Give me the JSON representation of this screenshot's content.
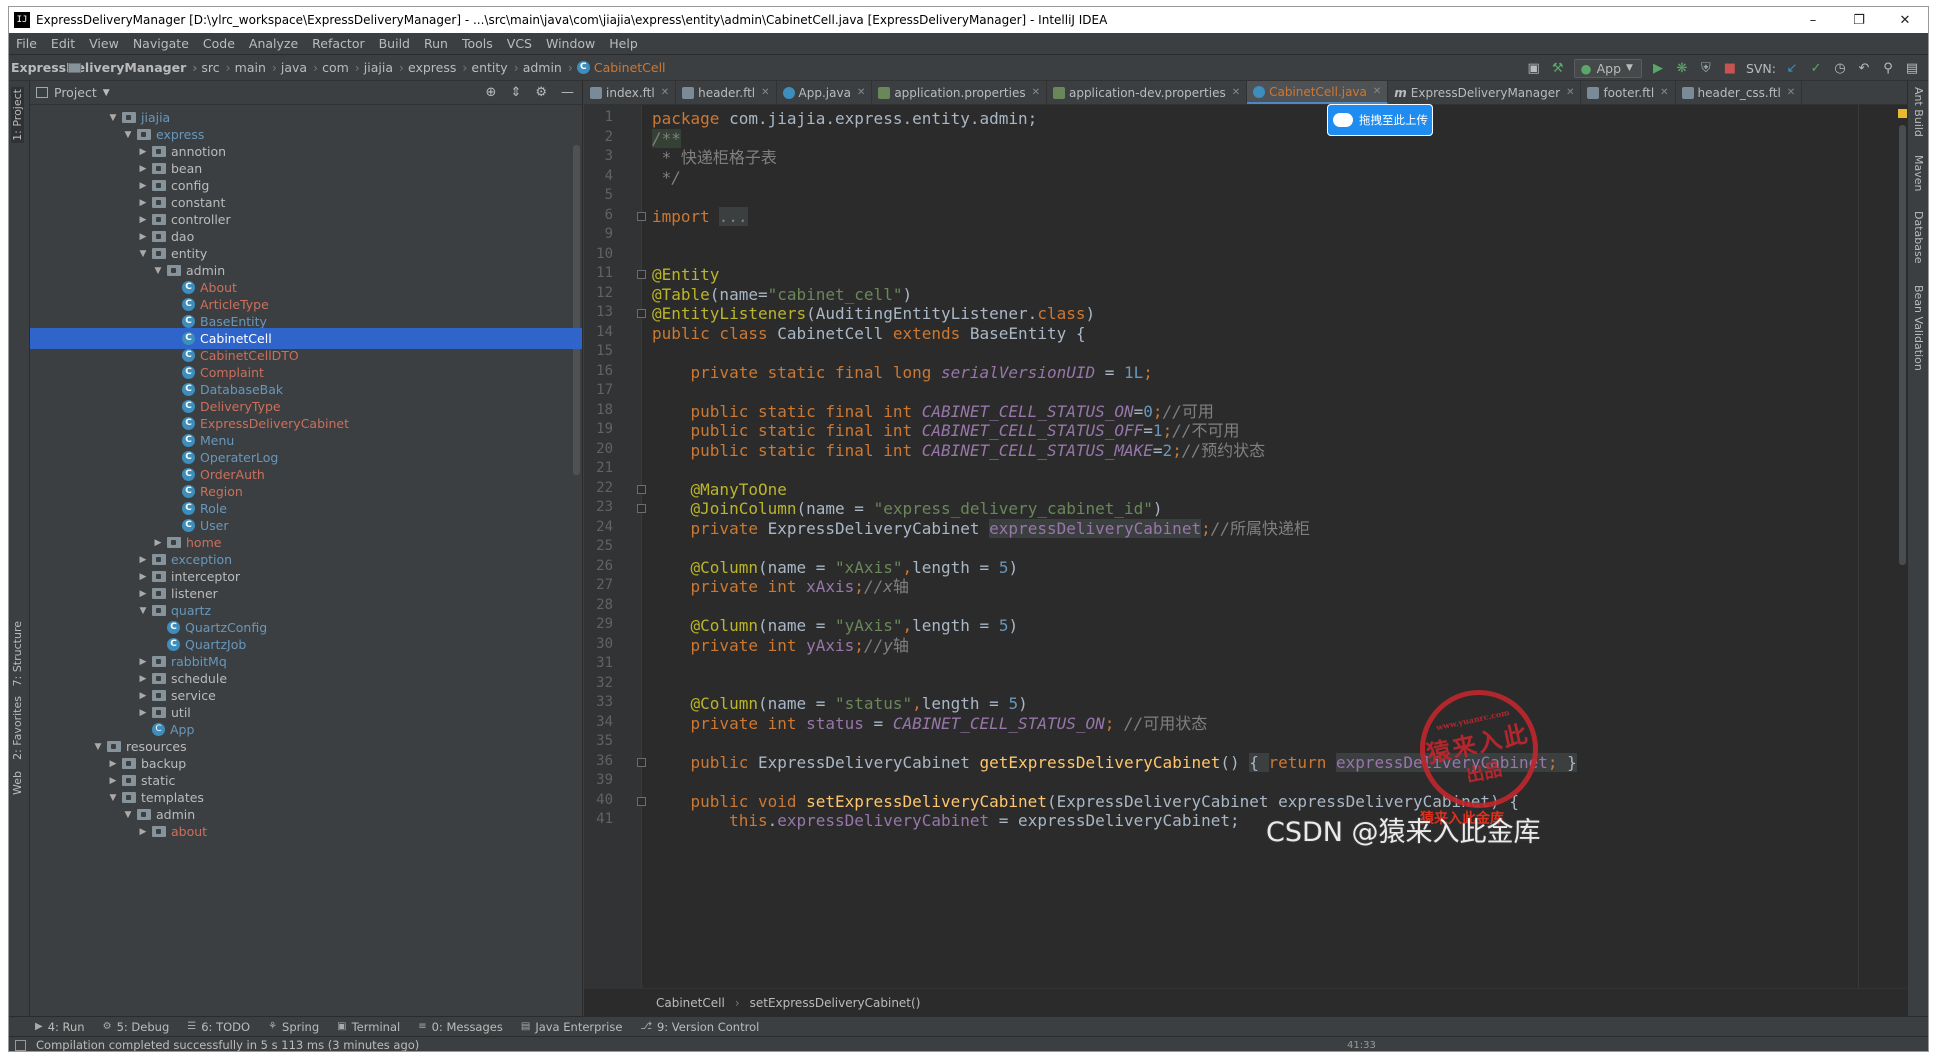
{
  "window": {
    "title": "ExpressDeliveryManager [D:\\ylrc_workspace\\ExpressDeliveryManager] - ...\\src\\main\\java\\com\\jiajia\\express\\entity\\admin\\CabinetCell.java [ExpressDeliveryManager] - IntelliJ IDEA",
    "controls": [
      "–",
      "❐",
      "✕"
    ]
  },
  "menu": [
    "File",
    "Edit",
    "View",
    "Navigate",
    "Code",
    "Analyze",
    "Refactor",
    "Build",
    "Run",
    "Tools",
    "VCS",
    "Window",
    "Help"
  ],
  "breadcrumbs": [
    "ExpressDeliveryManager",
    "src",
    "main",
    "java",
    "com",
    "jiajia",
    "express",
    "entity",
    "admin",
    "CabinetCell"
  ],
  "toolbar": {
    "run_config": "App",
    "svn_label": "SVN:"
  },
  "left_strip": {
    "project": "1: Project",
    "structure": "7: Structure",
    "favorites": "2: Favorites",
    "web": "Web"
  },
  "right_strip": {
    "ant": "Ant Build",
    "maven": "Maven",
    "database": "Database",
    "bean": "Bean Validation"
  },
  "project_panel": {
    "title": "Project",
    "tree": [
      {
        "label": "jiajia",
        "depth": 0,
        "kind": "pkg",
        "open": true,
        "style": "mod"
      },
      {
        "label": "express",
        "depth": 1,
        "kind": "pkg",
        "open": true,
        "style": "mod"
      },
      {
        "label": "annotion",
        "depth": 2,
        "kind": "pkg",
        "open": false,
        "style": ""
      },
      {
        "label": "bean",
        "depth": 2,
        "kind": "pkg",
        "open": false,
        "style": ""
      },
      {
        "label": "config",
        "depth": 2,
        "kind": "pkg",
        "open": false,
        "style": ""
      },
      {
        "label": "constant",
        "depth": 2,
        "kind": "pkg",
        "open": false,
        "style": ""
      },
      {
        "label": "controller",
        "depth": 2,
        "kind": "pkg",
        "open": false,
        "style": ""
      },
      {
        "label": "dao",
        "depth": 2,
        "kind": "pkg",
        "open": false,
        "style": ""
      },
      {
        "label": "entity",
        "depth": 2,
        "kind": "pkg",
        "open": true,
        "style": ""
      },
      {
        "label": "admin",
        "depth": 3,
        "kind": "pkg",
        "open": true,
        "style": ""
      },
      {
        "label": "About",
        "depth": 4,
        "kind": "class",
        "style": "err"
      },
      {
        "label": "ArticleType",
        "depth": 4,
        "kind": "class",
        "style": "err"
      },
      {
        "label": "BaseEntity",
        "depth": 4,
        "kind": "class",
        "style": "chg"
      },
      {
        "label": "CabinetCell",
        "depth": 4,
        "kind": "class",
        "style": "sel"
      },
      {
        "label": "CabinetCellDTO",
        "depth": 4,
        "kind": "class",
        "style": "err"
      },
      {
        "label": "Complaint",
        "depth": 4,
        "kind": "class",
        "style": "err"
      },
      {
        "label": "DatabaseBak",
        "depth": 4,
        "kind": "class",
        "style": "chg"
      },
      {
        "label": "DeliveryType",
        "depth": 4,
        "kind": "class",
        "style": "err"
      },
      {
        "label": "ExpressDeliveryCabinet",
        "depth": 4,
        "kind": "class",
        "style": "err"
      },
      {
        "label": "Menu",
        "depth": 4,
        "kind": "class",
        "style": "chg"
      },
      {
        "label": "OperaterLog",
        "depth": 4,
        "kind": "class",
        "style": "chg"
      },
      {
        "label": "OrderAuth",
        "depth": 4,
        "kind": "class",
        "style": "err"
      },
      {
        "label": "Region",
        "depth": 4,
        "kind": "class",
        "style": "err"
      },
      {
        "label": "Role",
        "depth": 4,
        "kind": "class",
        "style": "chg"
      },
      {
        "label": "User",
        "depth": 4,
        "kind": "class",
        "style": "chg"
      },
      {
        "label": "home",
        "depth": 3,
        "kind": "pkg",
        "open": false,
        "style": "err"
      },
      {
        "label": "exception",
        "depth": 2,
        "kind": "pkg",
        "open": false,
        "style": "mod"
      },
      {
        "label": "interceptor",
        "depth": 2,
        "kind": "pkg",
        "open": false,
        "style": ""
      },
      {
        "label": "listener",
        "depth": 2,
        "kind": "pkg",
        "open": false,
        "style": ""
      },
      {
        "label": "quartz",
        "depth": 2,
        "kind": "pkg",
        "open": true,
        "style": "mod"
      },
      {
        "label": "QuartzConfig",
        "depth": 3,
        "kind": "class",
        "style": "mod"
      },
      {
        "label": "QuartzJob",
        "depth": 3,
        "kind": "class",
        "style": "mod"
      },
      {
        "label": "rabbitMq",
        "depth": 2,
        "kind": "pkg",
        "open": false,
        "style": "mod"
      },
      {
        "label": "schedule",
        "depth": 2,
        "kind": "pkg",
        "open": false,
        "style": ""
      },
      {
        "label": "service",
        "depth": 2,
        "kind": "pkg",
        "open": false,
        "style": ""
      },
      {
        "label": "util",
        "depth": 2,
        "kind": "pkg",
        "open": false,
        "style": ""
      },
      {
        "label": "App",
        "depth": 2,
        "kind": "app",
        "style": "chg"
      },
      {
        "label": "resources",
        "depth": -1,
        "kind": "pkg",
        "open": true,
        "style": ""
      },
      {
        "label": "backup",
        "depth": 0,
        "kind": "pkg",
        "open": false,
        "style": ""
      },
      {
        "label": "static",
        "depth": 0,
        "kind": "pkg",
        "open": false,
        "style": ""
      },
      {
        "label": "templates",
        "depth": 0,
        "kind": "pkg",
        "open": true,
        "style": ""
      },
      {
        "label": "admin",
        "depth": 1,
        "kind": "pkg",
        "open": true,
        "style": ""
      },
      {
        "label": "about",
        "depth": 2,
        "kind": "pkg",
        "open": false,
        "style": "err"
      }
    ]
  },
  "tabs": [
    {
      "label": "index.ftl",
      "active": false,
      "icon": "ftl"
    },
    {
      "label": "header.ftl",
      "active": false,
      "icon": "ftl"
    },
    {
      "label": "App.java",
      "active": false,
      "icon": "class"
    },
    {
      "label": "application.properties",
      "active": false,
      "icon": "props"
    },
    {
      "label": "application-dev.properties",
      "active": false,
      "icon": "props"
    },
    {
      "label": "CabinetCell.java",
      "active": true,
      "icon": "class"
    },
    {
      "label": "ExpressDeliveryManager",
      "active": false,
      "icon": "maven"
    },
    {
      "label": "footer.ftl",
      "active": false,
      "icon": "ftl"
    },
    {
      "label": "header_css.ftl",
      "active": false,
      "icon": "ftl"
    }
  ],
  "upload_button": "拖拽至此上传",
  "code": {
    "line_numbers": [
      "1",
      "2",
      "3",
      "4",
      "5",
      "6",
      "9",
      "10",
      "11",
      "12",
      "13",
      "14",
      "15",
      "16",
      "17",
      "18",
      "19",
      "20",
      "21",
      "22",
      "23",
      "24",
      "25",
      "26",
      "27",
      "28",
      "29",
      "30",
      "31",
      "32",
      "33",
      "34",
      "35",
      "36",
      "39",
      "40",
      "41"
    ],
    "lines": [
      [
        [
          "kw",
          "package "
        ],
        [
          "",
          "com.jiajia.express.entity.admin;"
        ]
      ],
      [
        [
          "cm hl",
          "/**"
        ]
      ],
      [
        [
          "cm",
          " * "
        ],
        [
          "cmz",
          "快递柜格子表"
        ]
      ],
      [
        [
          "cm",
          " */"
        ]
      ],
      [
        [
          "",
          ""
        ]
      ],
      [
        [
          "kw",
          "import "
        ],
        [
          "hlg cm",
          "..."
        ]
      ],
      [
        [
          "",
          ""
        ]
      ],
      [
        [
          "",
          ""
        ]
      ],
      [
        [
          "an",
          "@Entity"
        ]
      ],
      [
        [
          "an",
          "@Table"
        ],
        [
          "",
          "(name="
        ],
        [
          "st",
          "\"cabinet_cell\""
        ],
        [
          "",
          ")"
        ]
      ],
      [
        [
          "an",
          "@EntityListeners"
        ],
        [
          "",
          "(AuditingEntityListener."
        ],
        [
          "kw",
          "class"
        ],
        [
          "",
          ")"
        ]
      ],
      [
        [
          "kw",
          "public class "
        ],
        [
          "",
          "CabinetCell "
        ],
        [
          "kw",
          "extends "
        ],
        [
          "",
          "BaseEntity {"
        ]
      ],
      [
        [
          "",
          ""
        ]
      ],
      [
        [
          "",
          "    "
        ],
        [
          "kw",
          "private static final long "
        ],
        [
          "ic",
          "serialVersionUID"
        ],
        [
          "",
          " = "
        ],
        [
          "nm",
          "1L"
        ],
        [
          "kw",
          ";"
        ]
      ],
      [
        [
          "",
          ""
        ]
      ],
      [
        [
          "",
          "    "
        ],
        [
          "kw",
          "public static final int "
        ],
        [
          "ic",
          "CABINET_CELL_STATUS_ON"
        ],
        [
          "",
          "="
        ],
        [
          "nm",
          "0"
        ],
        [
          "kw",
          ";"
        ],
        [
          "cm",
          "//"
        ],
        [
          "cmz",
          "可用"
        ]
      ],
      [
        [
          "",
          "    "
        ],
        [
          "kw",
          "public static final int "
        ],
        [
          "ic",
          "CABINET_CELL_STATUS_OFF"
        ],
        [
          "",
          "="
        ],
        [
          "nm",
          "1"
        ],
        [
          "kw",
          ";"
        ],
        [
          "cm",
          "//"
        ],
        [
          "cmz",
          "不可用"
        ]
      ],
      [
        [
          "",
          "    "
        ],
        [
          "kw",
          "public static final int "
        ],
        [
          "ic",
          "CABINET_CELL_STATUS_MAKE"
        ],
        [
          "",
          "="
        ],
        [
          "nm",
          "2"
        ],
        [
          "kw",
          ";"
        ],
        [
          "cm",
          "//"
        ],
        [
          "cmz",
          "预约状态"
        ]
      ],
      [
        [
          "",
          ""
        ]
      ],
      [
        [
          "",
          "    "
        ],
        [
          "an",
          "@ManyToOne"
        ]
      ],
      [
        [
          "",
          "    "
        ],
        [
          "an",
          "@JoinColumn"
        ],
        [
          "",
          "(name = "
        ],
        [
          "st",
          "\"express_delivery_cabinet_id\""
        ],
        [
          "",
          ")"
        ]
      ],
      [
        [
          "",
          "    "
        ],
        [
          "kw",
          "private "
        ],
        [
          "",
          "ExpressDeliveryCabinet "
        ],
        [
          "fieldref hlg",
          "expressDeliveryCabinet"
        ],
        [
          "kw",
          ";"
        ],
        [
          "cm",
          "//"
        ],
        [
          "cmz",
          "所属快递柜"
        ]
      ],
      [
        [
          "",
          ""
        ]
      ],
      [
        [
          "",
          "    "
        ],
        [
          "an",
          "@Column"
        ],
        [
          "",
          "(name = "
        ],
        [
          "st",
          "\"xAxis\""
        ],
        [
          "kw",
          ","
        ],
        [
          "",
          "length = "
        ],
        [
          "nm",
          "5"
        ],
        [
          "",
          ")"
        ]
      ],
      [
        [
          "",
          "    "
        ],
        [
          "kw",
          "private int "
        ],
        [
          "fieldref",
          "xAxis"
        ],
        [
          "kw",
          ";"
        ],
        [
          "cm",
          "//x"
        ],
        [
          "cmz",
          "轴"
        ]
      ],
      [
        [
          "",
          ""
        ]
      ],
      [
        [
          "",
          "    "
        ],
        [
          "an",
          "@Column"
        ],
        [
          "",
          "(name = "
        ],
        [
          "st",
          "\"yAxis\""
        ],
        [
          "kw",
          ","
        ],
        [
          "",
          "length = "
        ],
        [
          "nm",
          "5"
        ],
        [
          "",
          ")"
        ]
      ],
      [
        [
          "",
          "    "
        ],
        [
          "kw",
          "private int "
        ],
        [
          "fieldref",
          "yAxis"
        ],
        [
          "kw",
          ";"
        ],
        [
          "cm",
          "//y"
        ],
        [
          "cmz",
          "轴"
        ]
      ],
      [
        [
          "",
          ""
        ]
      ],
      [
        [
          "",
          ""
        ]
      ],
      [
        [
          "",
          "    "
        ],
        [
          "an",
          "@Column"
        ],
        [
          "",
          "(name = "
        ],
        [
          "st",
          "\"status\""
        ],
        [
          "kw",
          ","
        ],
        [
          "",
          "length = "
        ],
        [
          "nm",
          "5"
        ],
        [
          "",
          ")"
        ]
      ],
      [
        [
          "",
          "    "
        ],
        [
          "kw",
          "private int "
        ],
        [
          "fieldref",
          "status"
        ],
        [
          "",
          " = "
        ],
        [
          "ic",
          "CABINET_CELL_STATUS_ON"
        ],
        [
          "kw",
          "; "
        ],
        [
          "cm",
          "//"
        ],
        [
          "cmz",
          "可用状态"
        ]
      ],
      [
        [
          "",
          ""
        ]
      ],
      [
        [
          "",
          "    "
        ],
        [
          "kw",
          "public "
        ],
        [
          "",
          "ExpressDeliveryCabinet "
        ],
        [
          "fn",
          "getExpressDeliveryCabinet"
        ],
        [
          "",
          "() "
        ],
        [
          "hlg",
          "{ "
        ],
        [
          "kw",
          "return "
        ],
        [
          "fieldref hlg",
          "expressDeliveryCabinet"
        ],
        [
          "kw hlg",
          "; "
        ],
        [
          "hlg",
          "}"
        ]
      ],
      [
        [
          "",
          ""
        ]
      ],
      [
        [
          "",
          "    "
        ],
        [
          "kw",
          "public void "
        ],
        [
          "fn",
          "setExpressDeliveryCabinet"
        ],
        [
          "",
          "(ExpressDeliveryCabinet expressDeliveryCabinet) {"
        ]
      ],
      [
        [
          "",
          "        "
        ],
        [
          "kw",
          "this"
        ],
        [
          "",
          "."
        ],
        [
          "fieldref",
          "expressDeliveryCabinet"
        ],
        [
          "",
          " = expressDeliveryCabinet;"
        ]
      ]
    ]
  },
  "editor_breadcrumb": [
    "CabinetCell",
    "setExpressDeliveryCabinet()"
  ],
  "bottom_tools": [
    {
      "icon": "▶",
      "label": "4: Run"
    },
    {
      "icon": "⚙",
      "label": "5: Debug"
    },
    {
      "icon": "☰",
      "label": "6: TODO"
    },
    {
      "icon": "⚘",
      "label": "Spring"
    },
    {
      "icon": "▣",
      "label": "Terminal"
    },
    {
      "icon": "≡",
      "label": "0: Messages"
    },
    {
      "icon": "▤",
      "label": "Java Enterprise"
    },
    {
      "icon": "⎇",
      "label": "9: Version Control"
    }
  ],
  "status": "Compilation completed successfully in 5 s 113 ms (3 minutes ago)",
  "cursor_pos": "41:33",
  "watermarks": {
    "csdn": "CSDN @猿来入此金库",
    "stamp_top": "www.yuanrc.com",
    "stamp_main": "猿来入此",
    "stamp_bottom": "出品",
    "red_line": "猿来入此金库"
  }
}
